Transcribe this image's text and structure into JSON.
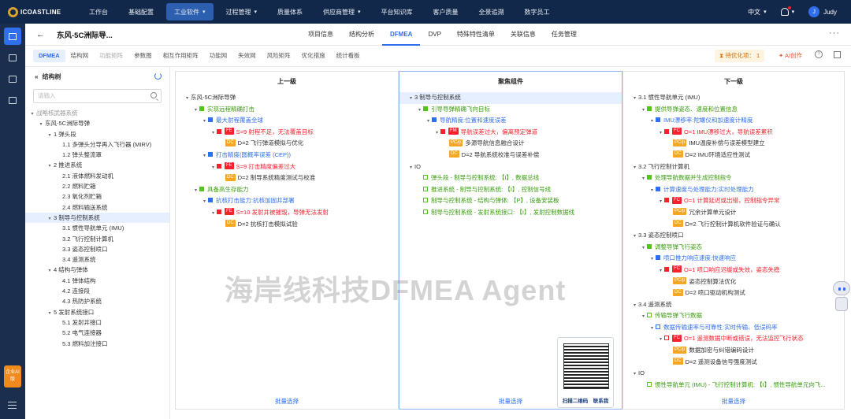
{
  "topbar": {
    "logo": "ICOASTLINE",
    "nav": [
      {
        "label": "工作台",
        "dropdown": false,
        "active": false
      },
      {
        "label": "基础配置",
        "dropdown": false,
        "active": false
      },
      {
        "label": "工业软件",
        "dropdown": true,
        "active": true
      },
      {
        "label": "过程管理",
        "dropdown": true,
        "active": false
      },
      {
        "label": "质量体系",
        "dropdown": false,
        "active": false
      },
      {
        "label": "供应商管理",
        "dropdown": true,
        "active": false
      },
      {
        "label": "平台知识库",
        "dropdown": false,
        "active": false
      },
      {
        "label": "客户质量",
        "dropdown": false,
        "active": false
      },
      {
        "label": "全景追溯",
        "dropdown": false,
        "active": false
      },
      {
        "label": "数字员工",
        "dropdown": false,
        "active": false
      }
    ],
    "language": "中文",
    "user_initial": "J",
    "user_name": "Judy"
  },
  "sidebar": {
    "ai_badge": "企业AI版"
  },
  "header": {
    "back": "←",
    "title": "东风-5C洲际导...",
    "tabs": [
      "项目信息",
      "结构分析",
      "DFMEA",
      "DVP",
      "特殊特性清单",
      "关联信息",
      "任务管理"
    ],
    "active_tab": "DFMEA",
    "more": "···"
  },
  "subtabs": {
    "items": [
      "DFMEA",
      "结构网",
      "功能矩阵",
      "参数图",
      "相互作用矩阵",
      "功能网",
      "失效网",
      "风险矩阵",
      "优化措施",
      "统计看板"
    ],
    "pending": "待优化项： 1",
    "ai_create": "AI创作"
  },
  "tree_panel": {
    "title": "结构树",
    "search_placeholder": "请输入",
    "rows": [
      {
        "label": "战略核武器系统",
        "indent": 0,
        "arrow": "▾",
        "gray": true
      },
      {
        "label": "东风-5C洲际导弹",
        "indent": 1,
        "arrow": "▾",
        "gray": false
      },
      {
        "label": "1 弹头段",
        "indent": 2,
        "arrow": "▾",
        "gray": false
      },
      {
        "label": "1.1 多弹头分导再入飞行器 (MIRV)",
        "indent": 3,
        "arrow": "",
        "gray": false
      },
      {
        "label": "1.2 弹头整流罩",
        "indent": 3,
        "arrow": "",
        "gray": false
      },
      {
        "label": "2 推进系统",
        "indent": 2,
        "arrow": "▾",
        "gray": false
      },
      {
        "label": "2.1 液体燃料发动机",
        "indent": 3,
        "arrow": "",
        "gray": false
      },
      {
        "label": "2.2 燃料贮箱",
        "indent": 3,
        "arrow": "",
        "gray": false
      },
      {
        "label": "2.3 氧化剂贮箱",
        "indent": 3,
        "arrow": "",
        "gray": false
      },
      {
        "label": "2.4 燃料输送系统",
        "indent": 3,
        "arrow": "",
        "gray": false
      },
      {
        "label": "3 制导与控制系统",
        "indent": 2,
        "arrow": "▾",
        "gray": false,
        "selected": true
      },
      {
        "label": "3.1 惯性导航单元 (IMU)",
        "indent": 3,
        "arrow": "",
        "gray": false
      },
      {
        "label": "3.2 飞行控制计算机",
        "indent": 3,
        "arrow": "",
        "gray": false
      },
      {
        "label": "3.3 姿态控制喷口",
        "indent": 3,
        "arrow": "",
        "gray": false
      },
      {
        "label": "3.4 遥测系统",
        "indent": 3,
        "arrow": "",
        "gray": false
      },
      {
        "label": "4 结构与弹体",
        "indent": 2,
        "arrow": "▾",
        "gray": false
      },
      {
        "label": "4.1 弹体结构",
        "indent": 3,
        "arrow": "",
        "gray": false
      },
      {
        "label": "4.2 连接段",
        "indent": 3,
        "arrow": "",
        "gray": false
      },
      {
        "label": "4.3 热防护系统",
        "indent": 3,
        "arrow": "",
        "gray": false
      },
      {
        "label": "5 发射系统接口",
        "indent": 2,
        "arrow": "▾",
        "gray": false
      },
      {
        "label": "5.1 发射井接口",
        "indent": 3,
        "arrow": "",
        "gray": false
      },
      {
        "label": "5.2 电气连接器",
        "indent": 3,
        "arrow": "",
        "gray": false
      },
      {
        "label": "5.3 燃料加注接口",
        "indent": 3,
        "arrow": "",
        "gray": false
      }
    ]
  },
  "columns": [
    {
      "title": "上一级",
      "footer": "批量选择",
      "rows": [
        {
          "i": 0,
          "a": "▾",
          "sq": "",
          "tag": "",
          "text": "东风-5C洲际导弹",
          "c": "t-dark"
        },
        {
          "i": 1,
          "a": "▾",
          "sq": "green",
          "tag": "",
          "text": "实现远程精确打击",
          "c": "t-green"
        },
        {
          "i": 2,
          "a": "▾",
          "sq": "blue",
          "tag": "",
          "text": "最大射程覆盖全球",
          "c": "t-blue"
        },
        {
          "i": 3,
          "a": "▾",
          "sq": "red",
          "tag": "FE",
          "text": "S=9 射程不足，无法覆盖目标",
          "c": "t-red"
        },
        {
          "i": 4,
          "a": "",
          "sq": "",
          "tag": "DC",
          "text": "D=2 飞行弹道模拟与优化",
          "c": "t-dark"
        },
        {
          "i": 2,
          "a": "▾",
          "sq": "blue",
          "tag": "",
          "text": "打击精度(圆概率误差 (CEP))",
          "c": "t-blue"
        },
        {
          "i": 3,
          "a": "▾",
          "sq": "red",
          "tag": "FE",
          "text": "S=9 打击精度偏差过大",
          "c": "t-red"
        },
        {
          "i": 4,
          "a": "",
          "sq": "",
          "tag": "DC",
          "text": "D=2 制导系统精度测试与校准",
          "c": "t-dark"
        },
        {
          "i": 1,
          "a": "▾",
          "sq": "green",
          "tag": "",
          "text": "具备高生存能力",
          "c": "t-green"
        },
        {
          "i": 2,
          "a": "▾",
          "sq": "blue",
          "tag": "",
          "text": "抗核打击能力:抗核加固井部署",
          "c": "t-blue"
        },
        {
          "i": 3,
          "a": "▾",
          "sq": "red",
          "tag": "FE",
          "text": "S=10 发射井被摧毁，导弹无法发射",
          "c": "t-red"
        },
        {
          "i": 4,
          "a": "",
          "sq": "",
          "tag": "DC",
          "text": "D=2 抗核打击模拟试验",
          "c": "t-dark"
        }
      ]
    },
    {
      "title": "聚焦组件",
      "footer": "批量选择",
      "rows": [
        {
          "i": 0,
          "a": "▾",
          "sq": "",
          "tag": "",
          "text": "3 制导与控制系统",
          "c": "t-dark",
          "hl": true
        },
        {
          "i": 1,
          "a": "▾",
          "sq": "green",
          "tag": "",
          "text": "引导导弹精确飞向目标",
          "c": "t-green"
        },
        {
          "i": 2,
          "a": "▾",
          "sq": "blue",
          "tag": "",
          "text": "导航精度:位置和速度误差",
          "c": "t-blue"
        },
        {
          "i": 3,
          "a": "▾",
          "sq": "red",
          "tag": "FM",
          "text": "导航误差过大，偏离预定弹道",
          "c": "t-red"
        },
        {
          "i": 4,
          "a": "",
          "sq": "",
          "tag": "PC/p",
          "text": "多源导航信息融合设计",
          "c": "t-dark"
        },
        {
          "i": 4,
          "a": "",
          "sq": "",
          "tag": "DC",
          "text": "D=2 导航系统校准与误差补偿",
          "c": "t-dark"
        },
        {
          "i": 0,
          "a": "▾",
          "sq": "",
          "tag": "",
          "text": "IO",
          "c": "t-dark"
        },
        {
          "i": 1,
          "a": "",
          "sq": "outline",
          "tag": "",
          "text": "弹头段 - 制导与控制系统: 【I】, 数据总线",
          "c": "t-green"
        },
        {
          "i": 1,
          "a": "",
          "sq": "outline",
          "tag": "",
          "text": "推进系统 - 制导与控制系统: 【I】, 控制信号线",
          "c": "t-green"
        },
        {
          "i": 1,
          "a": "",
          "sq": "outline",
          "tag": "",
          "text": "制导与控制系统 - 结构与弹体: 【P】, 设备安装板",
          "c": "t-green"
        },
        {
          "i": 1,
          "a": "",
          "sq": "outline",
          "tag": "",
          "text": "制导与控制系统 - 发射系统接口: 【I】, 发射控制数据线",
          "c": "t-green"
        }
      ]
    },
    {
      "title": "下一级",
      "footer": "批量选择",
      "rows": [
        {
          "i": 0,
          "a": "▾",
          "sq": "",
          "tag": "",
          "text": "3.1 惯性导航单元 (IMU)",
          "c": "t-dark"
        },
        {
          "i": 1,
          "a": "▾",
          "sq": "green",
          "tag": "",
          "text": "提供导弹姿态、速度和位置信息",
          "c": "t-green"
        },
        {
          "i": 2,
          "a": "▾",
          "sq": "blue",
          "tag": "",
          "text": "IMU漂移率:陀螺仪和加速度计精度",
          "c": "t-blue"
        },
        {
          "i": 3,
          "a": "▾",
          "sq": "red",
          "tag": "FC",
          "text": "O=1 IMU漂移过大，导航误差累积",
          "c": "t-red"
        },
        {
          "i": 4,
          "a": "",
          "sq": "",
          "tag": "PC/p",
          "text": "IMU温度补偿与误差模型建立",
          "c": "t-dark"
        },
        {
          "i": 4,
          "a": "",
          "sq": "",
          "tag": "DC",
          "text": "D=2 IMU环境适应性测试",
          "c": "t-dark"
        },
        {
          "i": 0,
          "a": "▾",
          "sq": "",
          "tag": "",
          "text": "3.2 飞行控制计算机",
          "c": "t-dark"
        },
        {
          "i": 1,
          "a": "▾",
          "sq": "green",
          "tag": "",
          "text": "处理导航数据并生成控制指令",
          "c": "t-green"
        },
        {
          "i": 2,
          "a": "▾",
          "sq": "blue",
          "tag": "",
          "text": "计算速度与处理能力:实时处理能力",
          "c": "t-blue"
        },
        {
          "i": 3,
          "a": "▾",
          "sq": "red",
          "tag": "FC",
          "text": "O=1 计算延迟或出错，控制指令异常",
          "c": "t-red"
        },
        {
          "i": 4,
          "a": "",
          "sq": "",
          "tag": "PC/p",
          "text": "冗余计算单元设计",
          "c": "t-dark"
        },
        {
          "i": 4,
          "a": "",
          "sq": "",
          "tag": "DC",
          "text": "D=2 飞行控制计算机软件验证与确认",
          "c": "t-dark"
        },
        {
          "i": 0,
          "a": "▾",
          "sq": "",
          "tag": "",
          "text": "3.3 姿态控制喷口",
          "c": "t-dark"
        },
        {
          "i": 1,
          "a": "▾",
          "sq": "green",
          "tag": "",
          "text": "调整导弹飞行姿态",
          "c": "t-green"
        },
        {
          "i": 2,
          "a": "▾",
          "sq": "blue",
          "tag": "",
          "text": "喷口推力响应速度:快速响应",
          "c": "t-blue"
        },
        {
          "i": 3,
          "a": "▾",
          "sq": "red",
          "tag": "FC",
          "text": "O=1 喷口响应迟缓或失效，姿态失稳",
          "c": "t-red"
        },
        {
          "i": 4,
          "a": "",
          "sq": "",
          "tag": "PC/p",
          "text": "姿态控制算法优化",
          "c": "t-dark"
        },
        {
          "i": 4,
          "a": "",
          "sq": "",
          "tag": "DC",
          "text": "D=2 喷口驱动机构测试",
          "c": "t-dark"
        },
        {
          "i": 0,
          "a": "▾",
          "sq": "",
          "tag": "",
          "text": "3.4 遥测系统",
          "c": "t-dark"
        },
        {
          "i": 1,
          "a": "▾",
          "sq": "outline",
          "tag": "",
          "text": "传输导弹飞行数据",
          "c": "t-green"
        },
        {
          "i": 2,
          "a": "▾",
          "sq": "outline-blue",
          "tag": "",
          "text": "数据传输速率与可靠性:实时传输、低误码率",
          "c": "t-blue"
        },
        {
          "i": 3,
          "a": "▾",
          "sq": "outline-red",
          "tag": "FC",
          "text": "O=1 遥测数据中断或错误，无法监控飞行状态",
          "c": "t-red"
        },
        {
          "i": 4,
          "a": "",
          "sq": "",
          "tag": "PC/p",
          "text": "数据加密与纠错编码设计",
          "c": "t-dark"
        },
        {
          "i": 4,
          "a": "",
          "sq": "",
          "tag": "DC",
          "text": "D=2 遥测设备信号强度测试",
          "c": "t-dark"
        },
        {
          "i": 0,
          "a": "▾",
          "sq": "",
          "tag": "",
          "text": "IO",
          "c": "t-dark"
        },
        {
          "i": 1,
          "a": "",
          "sq": "outline",
          "tag": "",
          "text": "惯性导航单元 (IMU) - 飞行控制计算机: 【I】, 惯性导航单元向飞...",
          "c": "t-green"
        }
      ]
    }
  ],
  "watermark": "海岸线科技DFMEA Agent",
  "qr_label": "扫描二维码　联系我"
}
